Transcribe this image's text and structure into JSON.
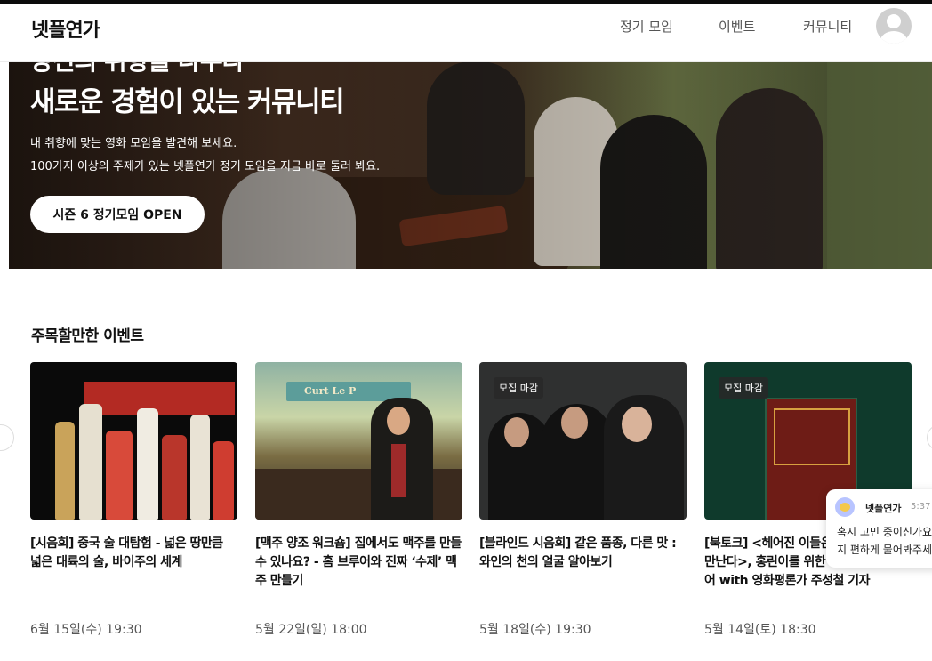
{
  "header": {
    "logo": "넷플연가",
    "nav": [
      "정기 모임",
      "이벤트",
      "커뮤니티"
    ]
  },
  "hero": {
    "title_cut": "당신의 취향을 나누다",
    "title": "새로운 경험이 있는 커뮤니티",
    "desc_lines": [
      "내 취향에 맞는 영화 모임을 발견해 보세요.",
      "100가지 이상의 주제가 있는 넷플연가 정기 모임을 지금 바로 둘러 봐요."
    ],
    "cta": "시즌 6 정기모임 OPEN"
  },
  "events": {
    "section_title": "주목할만한 이벤트",
    "cards": [
      {
        "badge": "",
        "title": "[시음회] 중국 술 대탐험 - 넓은 땅만큼 넓은 대륙의 술, 바이주의 세계",
        "date": "6월 15일(수) 19:30"
      },
      {
        "badge": "",
        "title": "[맥주 양조 워크숍] 집에서도 맥주를 만들 수 있나요? - 홈 브루어와 진짜 ‘수제’ 맥주 만들기",
        "date": "5월 22일(일) 18:00"
      },
      {
        "badge": "모집 마감",
        "title": "[블라인드 시음회] 같은 품종, 다른 맛 : 와인의 천의 얼굴 알아보기",
        "date": "5월 18일(수) 19:30"
      },
      {
        "badge": "모집 마감",
        "title": "[북토크] <헤어진 이들은 홍콩에서 다시 만난다>, 홍린이를 위한 랜선 시네마 투어 with 영화평론가 주성철 기자",
        "date": "5월 14일(토) 18:30"
      }
    ],
    "thumb2_sign": "Curt Le P"
  },
  "chat": {
    "name": "넷플연가",
    "time": "5:37",
    "lines": [
      "혹시 고민 중이신가요?",
      "지 편하게 물어봐주세요"
    ]
  }
}
